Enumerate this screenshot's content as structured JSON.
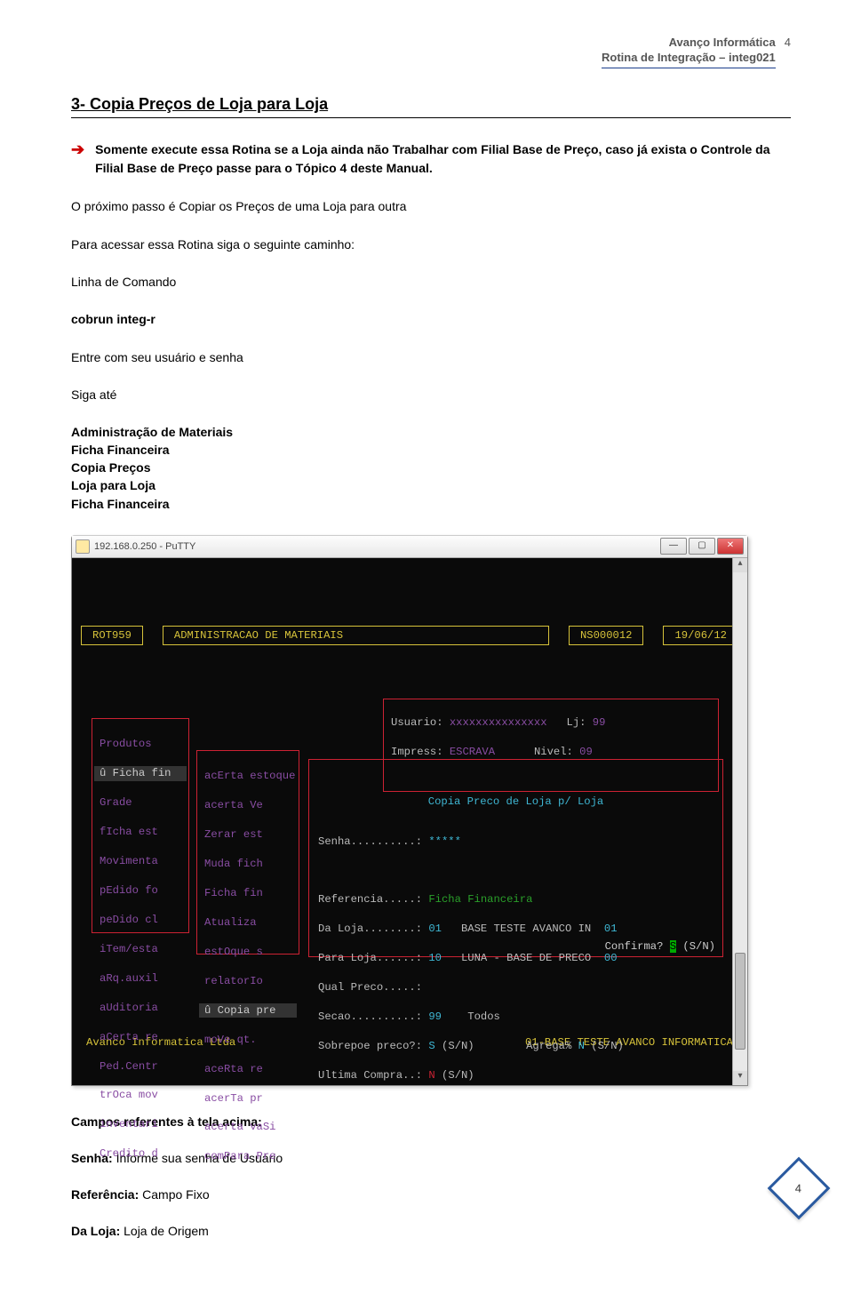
{
  "header": {
    "line1": "Avanço Informática",
    "line2": "Rotina de Integração – integ021",
    "pagenum_top": "4"
  },
  "section_title": "3-  Copia Preços de Loja para Loja",
  "note": "Somente execute essa Rotina se a Loja ainda não Trabalhar com Filial Base de Preço, caso já exista o Controle da Filial Base de Preço passe para o Tópico 4 deste Manual.",
  "p1": "O próximo passo é Copiar os Preços de uma Loja para outra",
  "p2": "Para acessar essa Rotina siga o seguinte caminho:",
  "p3": "Linha de Comando",
  "cmd": "cobrun integ-r",
  "p4": "Entre com seu usuário e senha",
  "p5": "Siga até",
  "menu_path": [
    "Administração de Materiais",
    "Ficha Financeira",
    "Copia Preços",
    "Loja para Loja",
    "Ficha Financeira"
  ],
  "putty_title": "192.168.0.250 - PuTTY",
  "term": {
    "rot": "ROT959",
    "title": "ADMINISTRACAO DE MATERIAIS",
    "code": "NS000012",
    "date": "19/06/12",
    "usuario_label": "Usuario:",
    "usuario": "xxxxxxxxxxxxxxx",
    "lj_label": "Lj:",
    "lj": "99",
    "impress_label": "Impress:",
    "impress": "ESCRAVA",
    "nivel_label": "Nivel:",
    "nivel": "09",
    "left_menu": [
      "Produtos",
      "û Ficha fin",
      "Grade",
      "fIcha est",
      "Movimenta",
      "pEdido fo",
      "peDido cl",
      "iTem/esta",
      "aRq.auxil",
      "aUditoria",
      "aCerta re",
      "Ped.Centr",
      "trOca mov",
      "inventari",
      "Credito d"
    ],
    "mid_menu": [
      "acErta estoque",
      "acerta Ve",
      "Zerar est",
      "Muda fich",
      "Ficha fin",
      "Atualiza",
      "estOque s",
      "relatorIo",
      "û Copia pre",
      "moVe qt.",
      "aceRta re",
      "acerTa pr",
      "acerta vaSi",
      "comPara Pre"
    ],
    "panel3_title": "Copia Preco de Loja p/ Loja",
    "senha_label": "Senha..........:",
    "senha_val": "*****",
    "ref_label": "Referencia.....:",
    "ref_val": "Ficha Financeira",
    "daloja_label": "Da Loja........:",
    "daloja_val": "01",
    "daloja_desc": "BASE TESTE AVANCO IN",
    "daloja_suf": "01",
    "paraloja_label": "Para Loja......:",
    "paraloja_val": "10",
    "paraloja_desc": "LUNA - BASE DE PRECO",
    "paraloja_suf": "00",
    "qualpreco_label": "Qual Preco.....:",
    "secao_label": "Secao..........:",
    "secao_val": "99",
    "secao_desc": "Todos",
    "sobrepoe_label": "Sobrepoe preco?:",
    "sobrepoe_val": "S",
    "sn": "(S/N)",
    "agrega_label": "Agrega%",
    "agrega_val": "N",
    "ultima_label": "Ultima Compra..:",
    "ultima_val": "N",
    "confirma": "Confirma?",
    "confirma_val": "S",
    "footer_left": "Avanco Informatica Ltda",
    "footer_right": "01-BASE TESTE AVANCO INFORMATICA"
  },
  "fields_title": "Campos referentes à tela acima:",
  "fields": {
    "senha_lbl": "Senha:",
    "senha_txt": " Informe sua senha de Usuário",
    "ref_lbl": "Referência:",
    "ref_txt": " Campo Fixo",
    "daloja_lbl": "Da Loja:",
    "daloja_txt": " Loja de Origem"
  },
  "page_num_bottom": "4"
}
